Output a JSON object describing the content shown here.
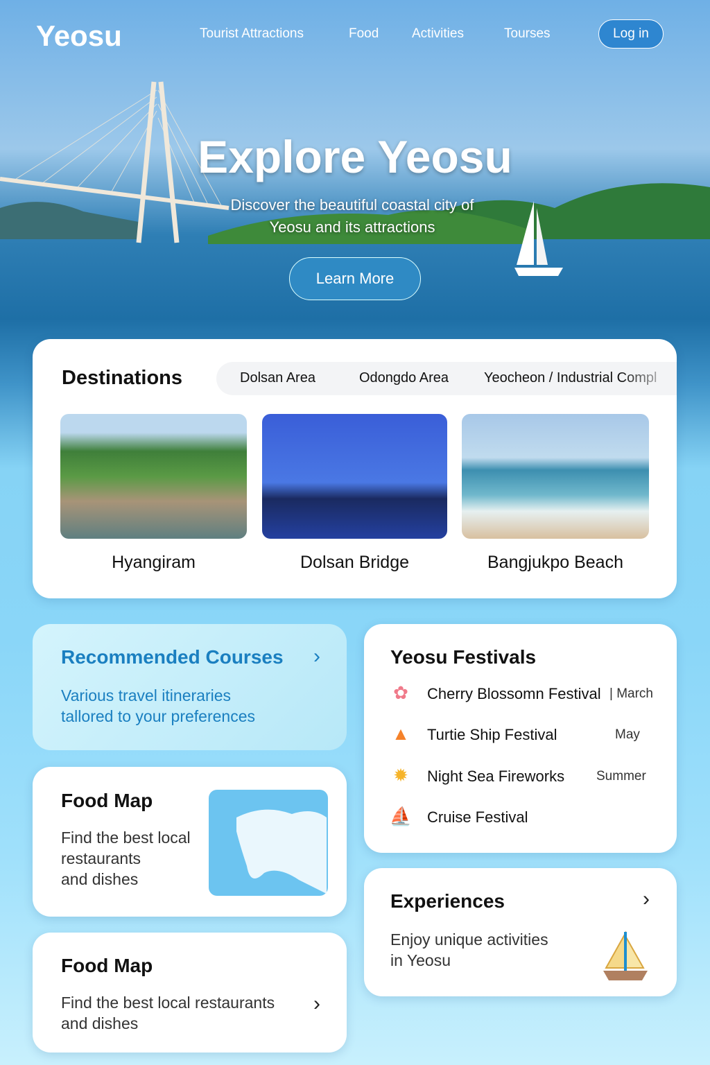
{
  "nav": {
    "logo": "Yeosu",
    "links": [
      "Tourist Attractions",
      "Food",
      "Activities",
      "Tourses"
    ],
    "login": "Log in"
  },
  "hero": {
    "title": "Explore Yeosu",
    "subtitle_1": "Discover the beautiful coastal city of",
    "subtitle_2": "Yeosu and its attractions",
    "cta": "Learn More"
  },
  "destinations": {
    "title": "Destinations",
    "tabs": [
      "Dolsan Area",
      "Odongdo Area",
      "Yeocheon / Industrial Compl"
    ],
    "items": [
      {
        "name": "Hyangiram"
      },
      {
        "name": "Dolsan Bridge"
      },
      {
        "name": "Bangjukpo Beach"
      }
    ]
  },
  "recommended": {
    "title": "Recommended Courses",
    "desc_1": "Various travel itineraries",
    "desc_2": "tallored to your preferences"
  },
  "festivals": {
    "title": "Yeosu Festivals",
    "items": [
      {
        "name": "Cherry Blossomn Festival",
        "month": "| March",
        "icon": "cherry-blossom-icon",
        "color": "#f07a8a"
      },
      {
        "name": "Turtie Ship Festival",
        "month": "May",
        "icon": "turtle-ship-icon",
        "color": "#f5822a"
      },
      {
        "name": "Night Sea Fireworks",
        "month": "Summer",
        "icon": "fireworks-icon",
        "color": "#f6b42a"
      },
      {
        "name": "Cruise Festival",
        "month": "",
        "icon": "sailboat-icon",
        "color": "#1d8fd0"
      }
    ]
  },
  "foodmap1": {
    "title": "Food Map",
    "desc_1": "Find the best local",
    "desc_2": "restaurants",
    "desc_3": "and dishes"
  },
  "experiences": {
    "title": "Experiences",
    "desc_1": "Enjoy unique activities",
    "desc_2": "in Yeosu"
  },
  "foodmap2": {
    "title": "Food Map",
    "desc_1": "Find the best local restaurants",
    "desc_2": "and dishes"
  },
  "colors": {
    "accent": "#1a7fc0",
    "button": "#2f8ac4"
  }
}
